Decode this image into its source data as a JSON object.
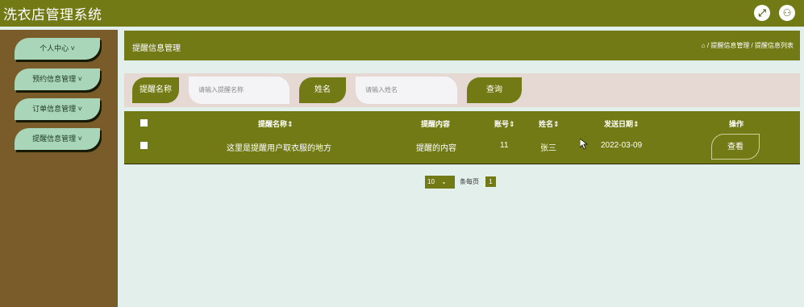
{
  "app": {
    "title": "洗衣店管理系统"
  },
  "topbar": {
    "fullscreen_icon": "fullscreen-icon",
    "user_icon": "user-icon"
  },
  "sidebar": {
    "items": [
      {
        "label": "个人中心"
      },
      {
        "label": "预约信息管理"
      },
      {
        "label": "订单信息管理"
      },
      {
        "label": "提醒信息管理"
      }
    ]
  },
  "header": {
    "title": "提醒信息管理",
    "breadcrumb": {
      "home_icon": "home-icon",
      "text": "/ 提醒信息管理 / 提醒信息列表"
    }
  },
  "search": {
    "label_name": "提醒名称",
    "placeholder_name": "请输入提醒名称",
    "label_person": "姓名",
    "placeholder_person": "请输入姓名",
    "query_button": "查询"
  },
  "table": {
    "columns": [
      "提醒名称⇕",
      "提醒内容",
      "账号⇕",
      "姓名⇕",
      "发送日期⇕",
      "操作"
    ],
    "rows": [
      {
        "name": "这里是提醒用户取衣服的地方",
        "content": "提醒的内容",
        "account": "11",
        "person": "张三",
        "date": "2022-03-09",
        "action": "查看"
      }
    ]
  },
  "pagination": {
    "page_size": "10",
    "per_page_label": "条每页",
    "current_page": "1"
  },
  "colors": {
    "primary": "#727a16",
    "sidebar": "#7a5b2a",
    "menu_item": "#a9d6b9",
    "search_bg": "#e6d8d3",
    "page_bg": "#e3efea"
  }
}
